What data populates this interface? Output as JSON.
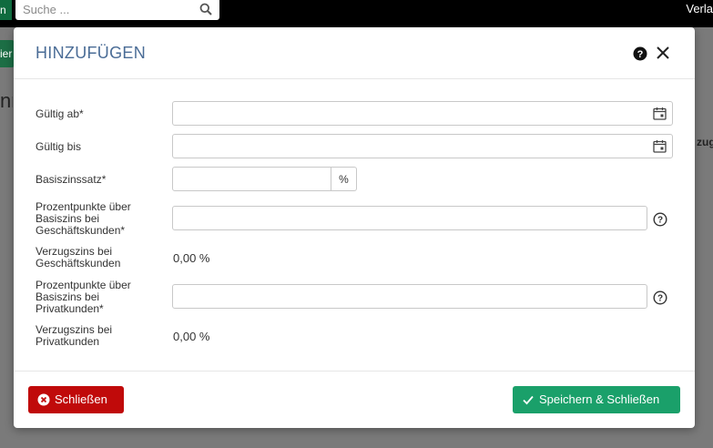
{
  "background": {
    "green_tab_text": "n",
    "search_placeholder": "Suche ...",
    "right_text": "Verla",
    "green_button_text": "ier",
    "big_text": "nr",
    "column_text": "zugs"
  },
  "modal": {
    "title": "HINZUFÜGEN",
    "fields": {
      "gueltig_ab": {
        "label": "Gültig ab*",
        "value": ""
      },
      "gueltig_bis": {
        "label": "Gültig bis",
        "value": ""
      },
      "basiszinssatz": {
        "label": "Basiszinssatz*",
        "value": "",
        "addon": "%"
      },
      "pp_geschaeft": {
        "label_lines": [
          "Prozentpunkte über",
          "Basiszins bei",
          "Geschäftskunden*"
        ],
        "value": ""
      },
      "verzug_geschaeft": {
        "label_lines": [
          "Verzugszins bei",
          "Geschäftskunden"
        ],
        "value": "0,00 %"
      },
      "pp_privat": {
        "label_lines": [
          "Prozentpunkte über",
          "Basiszins bei",
          "Privatkunden*"
        ],
        "value": ""
      },
      "verzug_privat": {
        "label_lines": [
          "Verzugszins bei",
          "Privatkunden"
        ],
        "value": "0,00 %"
      }
    },
    "buttons": {
      "close_label": "Schließen",
      "save_label": "Speichern & Schließen"
    }
  },
  "colors": {
    "title": "#4a6c96",
    "danger": "#c00a0a",
    "success": "#1aa06a"
  },
  "icons": [
    "search-icon",
    "help-icon",
    "close-icon",
    "calendar-icon",
    "question-circle-icon",
    "x-circle-icon",
    "check-icon"
  ]
}
